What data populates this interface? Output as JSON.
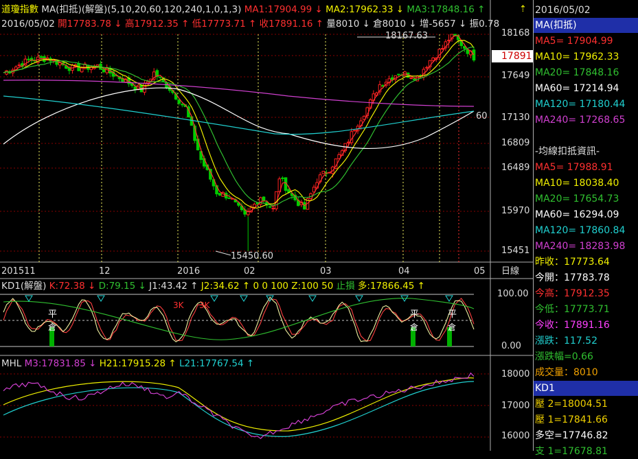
{
  "colors": {
    "up": "#ff2020",
    "down": "#00cc00",
    "ma5": "#ff3030",
    "ma10": "#f0f000",
    "ma20": "#30c030",
    "ma60": "#ffffff",
    "ma120": "#20d0d0",
    "ma240": "#d040d0",
    "grid": "#8a0000",
    "vline": "#f0f060"
  },
  "header": {
    "line1": {
      "name": "道瓊指數",
      "indicator": "MA(扣抵)(解盤)(5,10,20,60,120,240,1,0,1,3)",
      "ma1": "MA1:17904.99 ↓",
      "ma2": "MA2:17962.33 ↓",
      "ma3": "MA3:17848.16 ↑"
    },
    "line2": {
      "date": "2016/05/02",
      "open": "開17783.78 ↓",
      "high": "高17912.35 ↑",
      "low": "低17773.71 ↑",
      "close": "收17891.16 ↑",
      "vol": "量8010 ↓",
      "oi": "倉8010 ↓",
      "chg": "增-5657 ↓",
      "amp": "振0.78"
    }
  },
  "main_axis": {
    "ticks": [
      "18168",
      "17891",
      "17649",
      "17130",
      "16809",
      "16489",
      "15970",
      "15451"
    ],
    "current": "17891"
  },
  "annotations": {
    "high_label": "18167.63",
    "low_label": "15450.60",
    "ma_label": "60"
  },
  "x_axis": {
    "labels": [
      "201511",
      "12",
      "2016",
      "02",
      "03",
      "04",
      "05"
    ],
    "unit": "日線"
  },
  "kd": {
    "title": "KD1(解盤)",
    "k": "K:72.38 ↓",
    "d": "D:79.15 ↓",
    "j1": "J1:43.42 ↑",
    "j2": "J2:34.62 ↑",
    "flags": "0 0 100 Z:100 50",
    "stop": "止損",
    "long": "多:17866.45 ↑",
    "ticks": [
      "100.00",
      "0.00"
    ],
    "marks": [
      "平",
      "倉",
      "3K",
      "3K",
      "平",
      "倉",
      "平",
      "倉"
    ]
  },
  "mhl": {
    "title": "MHL",
    "m3": "M3:17831.85 ↓",
    "h21": "H21:17915.28 ↑",
    "l21": "L21:17767.54 ↑",
    "ticks": [
      "18000",
      "17000",
      "16000"
    ]
  },
  "sidebar": {
    "date": "2016/05/02",
    "section1": "MA(扣抵)",
    "ma1": [
      "MA5= 17904.99",
      "MA10= 17962.33",
      "MA20= 17848.16",
      "MA60= 17214.94",
      "MA120= 17180.44",
      "MA240= 17268.65"
    ],
    "section2": "-均線扣抵資訊-",
    "ma2": [
      "MA5= 17988.91",
      "MA10= 18038.40",
      "MA20= 17654.73",
      "MA60= 16294.09",
      "MA120= 17860.84",
      "MA240= 18283.98"
    ],
    "quotes": [
      "昨收：17773.64",
      "今開：17783.78",
      "今高：17912.35",
      "今低：17773.71",
      "今收：17891.16",
      "漲跌：117.52",
      "漲跌幅=0.66",
      "成交量：8010"
    ],
    "section3": "KD1",
    "kd": [
      "壓 2=18004.51",
      "壓 1=17841.66",
      "多空=17746.82",
      "支 1=17678.81"
    ]
  },
  "chart_data": [
    {
      "type": "line",
      "title": "道瓊指數",
      "y_ticks": [
        18168,
        17649,
        17130,
        16809,
        16489,
        15970,
        15451
      ],
      "high": 18167.63,
      "low": 15450.6,
      "last": 17891,
      "x_labels": [
        "201511",
        "12",
        "2016",
        "02",
        "03",
        "04",
        "05"
      ],
      "series": [
        {
          "name": "MA1",
          "last": 17904.99
        },
        {
          "name": "MA2",
          "last": 17962.33
        },
        {
          "name": "MA3",
          "last": 17848.16
        }
      ]
    },
    {
      "type": "line",
      "title": "KD1(解盤)",
      "ylim": [
        0,
        100
      ],
      "series": [
        {
          "name": "K",
          "last": 72.38
        },
        {
          "name": "D",
          "last": 79.15
        }
      ]
    },
    {
      "type": "line",
      "title": "MHL",
      "y_ticks": [
        18000,
        17000,
        16000
      ],
      "series": [
        {
          "name": "M3",
          "last": 17831.85
        },
        {
          "name": "H21",
          "last": 17915.28
        },
        {
          "name": "L21",
          "last": 17767.54
        }
      ]
    }
  ]
}
